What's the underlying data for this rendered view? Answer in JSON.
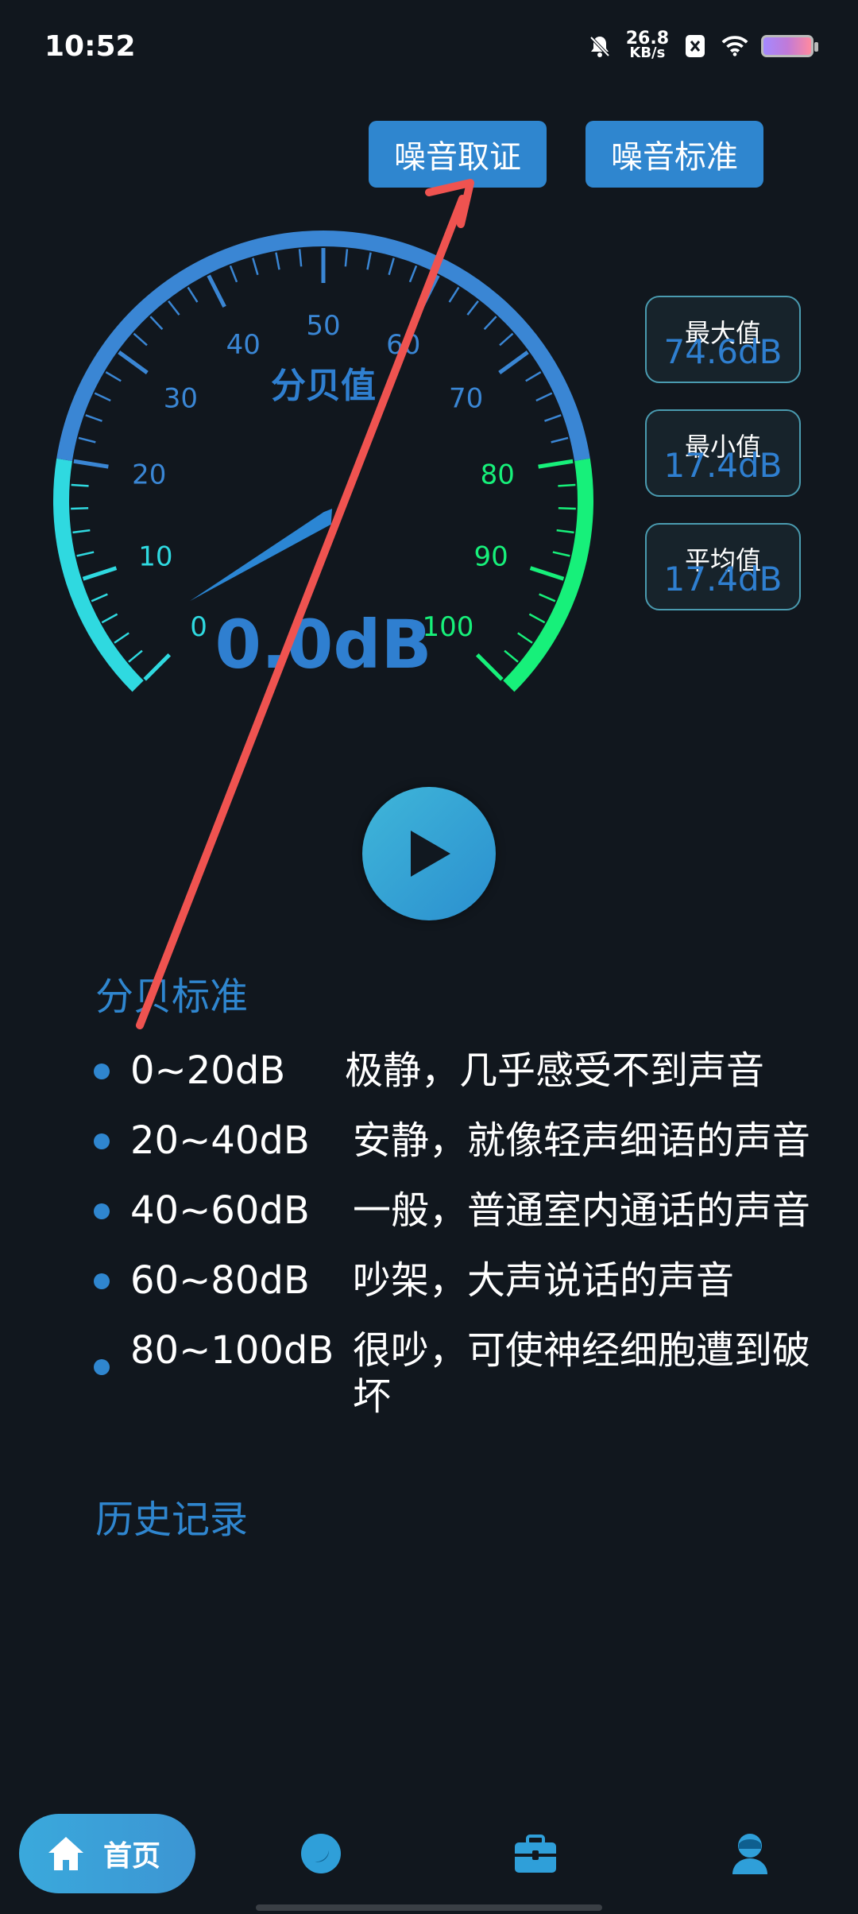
{
  "status_bar": {
    "time": "10:52",
    "speed_value": "26.8",
    "speed_unit": "KB/s"
  },
  "header_buttons": {
    "forensics_label": "噪音取证",
    "standard_label": "噪音标准"
  },
  "gauge": {
    "title": "分贝值",
    "reading": "0.0dB",
    "scale_labels": [
      "0",
      "10",
      "20",
      "30",
      "40",
      "50",
      "60",
      "70",
      "80",
      "90",
      "100"
    ],
    "min": 0,
    "max": 100,
    "current_value": 0
  },
  "stats": {
    "max_label": "最大值",
    "max_value": "74.6dB",
    "min_label": "最小值",
    "min_value": "17.4dB",
    "avg_label": "平均值",
    "avg_value": "17.4dB"
  },
  "decibel_standard": {
    "title": "分贝标准",
    "rows": [
      {
        "range": "0~20dB",
        "desc": "极静，几乎感受不到声音"
      },
      {
        "range": "20~40dB",
        "desc": "安静，就像轻声细语的声音"
      },
      {
        "range": "40~60dB",
        "desc": "一般，普通室内通话的声音"
      },
      {
        "range": "60~80dB",
        "desc": "吵架，大声说话的声音"
      },
      {
        "range": "80~100dB",
        "desc": "很吵，可使神经细胞遭到破坏"
      }
    ]
  },
  "history": {
    "title": "历史记录"
  },
  "bottom_nav": {
    "home_label": "首页",
    "icons": [
      "home-icon",
      "moon-icon",
      "toolbox-icon",
      "profile-icon"
    ]
  },
  "colors": {
    "background": "#11171e",
    "accent": "#2f86cf",
    "gauge_blue": "#3a86d4",
    "gauge_cyan": "#2fd9e0",
    "gauge_green": "#17f07a",
    "annotation_arrow": "#ef5350"
  }
}
